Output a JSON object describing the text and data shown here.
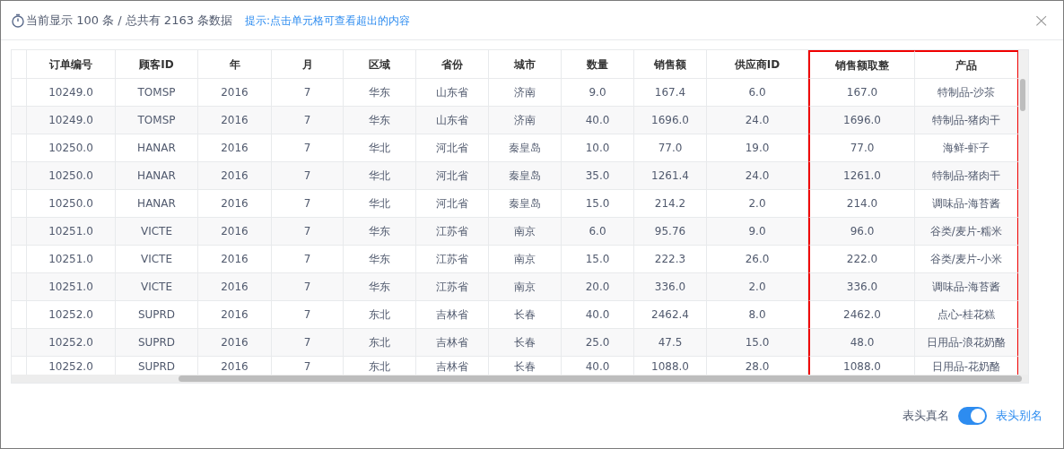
{
  "header": {
    "summary": "当前显示 100 条 / 总共有 2163 条数据",
    "hint": "提示:点击单元格可查看超出的内容",
    "close": "×"
  },
  "table": {
    "columns": [
      {
        "label": "订单编号",
        "highlighted": false
      },
      {
        "label": "顾客ID",
        "highlighted": false
      },
      {
        "label": "年",
        "highlighted": false
      },
      {
        "label": "月",
        "highlighted": false
      },
      {
        "label": "区域",
        "highlighted": false
      },
      {
        "label": "省份",
        "highlighted": false
      },
      {
        "label": "城市",
        "highlighted": false
      },
      {
        "label": "数量",
        "highlighted": false
      },
      {
        "label": "销售额",
        "highlighted": false
      },
      {
        "label": "供应商ID",
        "highlighted": false
      },
      {
        "label": "销售额取整",
        "highlighted": true
      },
      {
        "label": "产品",
        "highlighted": true
      }
    ],
    "rows": [
      [
        "10249.0",
        "TOMSP",
        "2016",
        "7",
        "华东",
        "山东省",
        "济南",
        "9.0",
        "167.4",
        "6.0",
        "167.0",
        "特制品-沙茶"
      ],
      [
        "10249.0",
        "TOMSP",
        "2016",
        "7",
        "华东",
        "山东省",
        "济南",
        "40.0",
        "1696.0",
        "24.0",
        "1696.0",
        "特制品-猪肉干"
      ],
      [
        "10250.0",
        "HANAR",
        "2016",
        "7",
        "华北",
        "河北省",
        "秦皇岛",
        "10.0",
        "77.0",
        "19.0",
        "77.0",
        "海鲜-虾子"
      ],
      [
        "10250.0",
        "HANAR",
        "2016",
        "7",
        "华北",
        "河北省",
        "秦皇岛",
        "35.0",
        "1261.4",
        "24.0",
        "1261.0",
        "特制品-猪肉干"
      ],
      [
        "10250.0",
        "HANAR",
        "2016",
        "7",
        "华北",
        "河北省",
        "秦皇岛",
        "15.0",
        "214.2",
        "2.0",
        "214.0",
        "调味品-海苔酱"
      ],
      [
        "10251.0",
        "VICTE",
        "2016",
        "7",
        "华东",
        "江苏省",
        "南京",
        "6.0",
        "95.76",
        "9.0",
        "96.0",
        "谷类/麦片-糯米"
      ],
      [
        "10251.0",
        "VICTE",
        "2016",
        "7",
        "华东",
        "江苏省",
        "南京",
        "15.0",
        "222.3",
        "26.0",
        "222.0",
        "谷类/麦片-小米"
      ],
      [
        "10251.0",
        "VICTE",
        "2016",
        "7",
        "华东",
        "江苏省",
        "南京",
        "20.0",
        "336.0",
        "2.0",
        "336.0",
        "调味品-海苔酱"
      ],
      [
        "10252.0",
        "SUPRD",
        "2016",
        "7",
        "东北",
        "吉林省",
        "长春",
        "40.0",
        "2462.4",
        "8.0",
        "2462.0",
        "点心-桂花糕"
      ],
      [
        "10252.0",
        "SUPRD",
        "2016",
        "7",
        "东北",
        "吉林省",
        "长春",
        "25.0",
        "47.5",
        "15.0",
        "48.0",
        "日用品-浪花奶酪"
      ],
      [
        "10252.0",
        "SUPRD",
        "2016",
        "7",
        "东北",
        "吉林省",
        "长春",
        "40.0",
        "1088.0",
        "28.0",
        "1088.0",
        "日用品-花奶酪"
      ]
    ]
  },
  "footer": {
    "label_off": "表头真名",
    "label_on": "表头别名",
    "on": true
  }
}
